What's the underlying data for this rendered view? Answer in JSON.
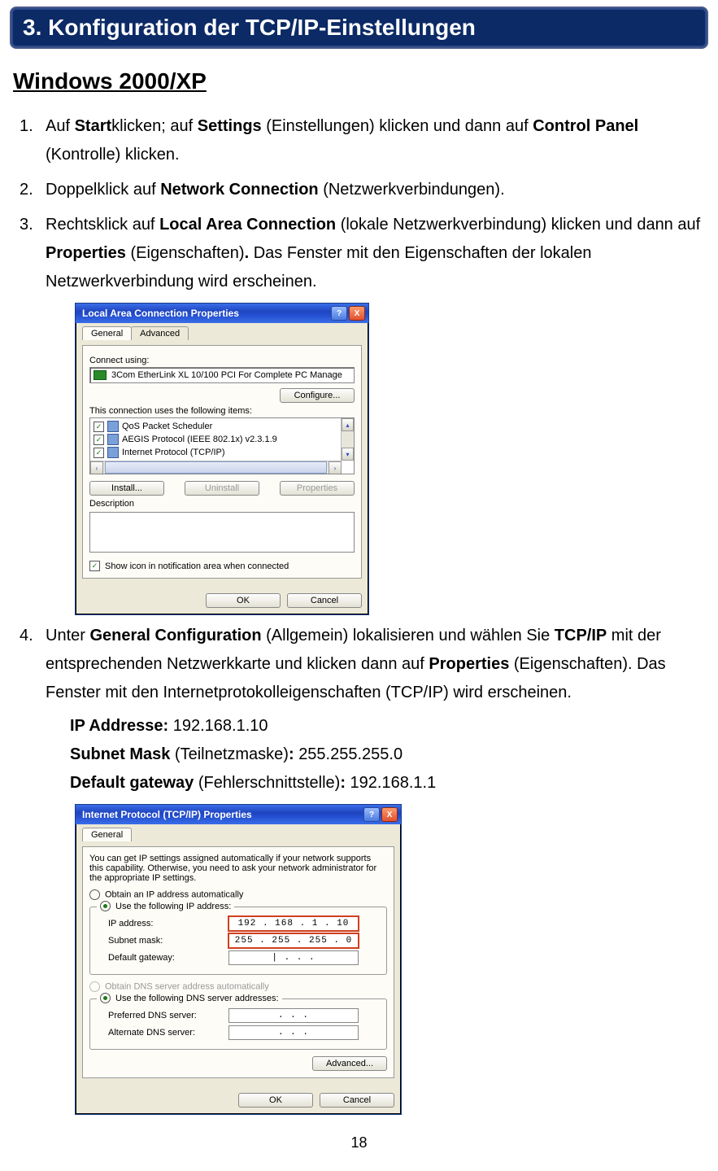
{
  "banner": "3. Konfiguration der TCP/IP-Einstellungen",
  "subsection": "Windows 2000/XP",
  "steps": {
    "s1": {
      "no": "1.",
      "a": "Auf ",
      "b": "Start",
      "c": "klicken; auf ",
      "d": "Settings",
      "e": " (Einstellungen) klicken und dann auf ",
      "f": "Control Panel",
      "g": " (Kontrolle) klicken."
    },
    "s2": {
      "no": "2.",
      "a": "Doppelklick auf ",
      "b": "Network Connection",
      "c": " (Netzwerkverbindungen)."
    },
    "s3": {
      "no": "3.",
      "a": "Rechtsklick auf ",
      "b": "Local Area Connection",
      "c": " (lokale Netzwerkverbindung) klicken und dann auf ",
      "d": "Properties",
      "e": " (Eigenschaften)",
      "f": ".",
      "g": " Das Fenster mit den Eigenschaften der lokalen Netzwerkverbindung wird erscheinen."
    },
    "s4": {
      "no": "4.",
      "a": "Unter ",
      "b": "General Configuration",
      "c": " (Allgemein) lokalisieren und wählen Sie ",
      "d": "TCP/IP",
      "e": " mit der entsprechenden Netzwerkkarte und klicken dann auf ",
      "f": "Properties",
      "g": " (Eigenschaften). Das Fenster mit den Internetprotokolleigenschaften (TCP/IP) wird erscheinen."
    }
  },
  "ip_block": {
    "ip_label": "IP Addresse: ",
    "ip_value": "192.168.1.10",
    "sm_label_b": "Subnet Mask",
    "sm_label_p": " (Teilnetzmaske)",
    "sm_colon": ": ",
    "sm_value": "255.255.255.0",
    "gw_label_b": "Default gateway",
    "gw_label_p": " (Fehlerschnittstelle)",
    "gw_colon": ": ",
    "gw_value": "192.168.1.1"
  },
  "dlg1": {
    "title": "Local Area Connection Properties",
    "help_glyph": "?",
    "close_glyph": "X",
    "tab_general": "General",
    "tab_advanced": "Advanced",
    "connect_using": "Connect using:",
    "nic": "3Com EtherLink XL 10/100 PCI For Complete PC Manage",
    "configure_btn": "Configure...",
    "uses_items": "This connection uses the following items:",
    "items": [
      "QoS Packet Scheduler",
      "AEGIS Protocol (IEEE 802.1x) v2.3.1.9",
      "Internet Protocol (TCP/IP)"
    ],
    "install_btn": "Install...",
    "uninstall_btn": "Uninstall",
    "properties_btn": "Properties",
    "description_label": "Description",
    "show_icon": "Show icon in notification area when connected",
    "ok": "OK",
    "cancel": "Cancel",
    "check_glyph": "✓",
    "arrow_left": "‹",
    "arrow_right": "›",
    "arrow_up": "▴",
    "arrow_down": "▾"
  },
  "dlg2": {
    "title": "Internet Protocol (TCP/IP) Properties",
    "help_glyph": "?",
    "close_glyph": "X",
    "tab_general": "General",
    "intro": "You can get IP settings assigned automatically if your network supports this capability. Otherwise, you need to ask your network administrator for the appropriate IP settings.",
    "radio_obtain_ip": "Obtain an IP address automatically",
    "radio_use_ip": "Use the following IP address:",
    "lbl_ip": "IP address:",
    "val_ip": "192 . 168 .   1  .  10",
    "lbl_sm": "Subnet mask:",
    "val_sm": "255 . 255 . 255 .   0",
    "lbl_gw": "Default gateway:",
    "val_gw": "|      .        .        .",
    "radio_obtain_dns": "Obtain DNS server address automatically",
    "radio_use_dns": "Use the following DNS server addresses:",
    "lbl_pref_dns": "Preferred DNS server:",
    "val_pref_dns": ".        .        .",
    "lbl_alt_dns": "Alternate DNS server:",
    "val_alt_dns": ".        .        .",
    "advanced_btn": "Advanced...",
    "ok": "OK",
    "cancel": "Cancel"
  },
  "page_number": "18"
}
